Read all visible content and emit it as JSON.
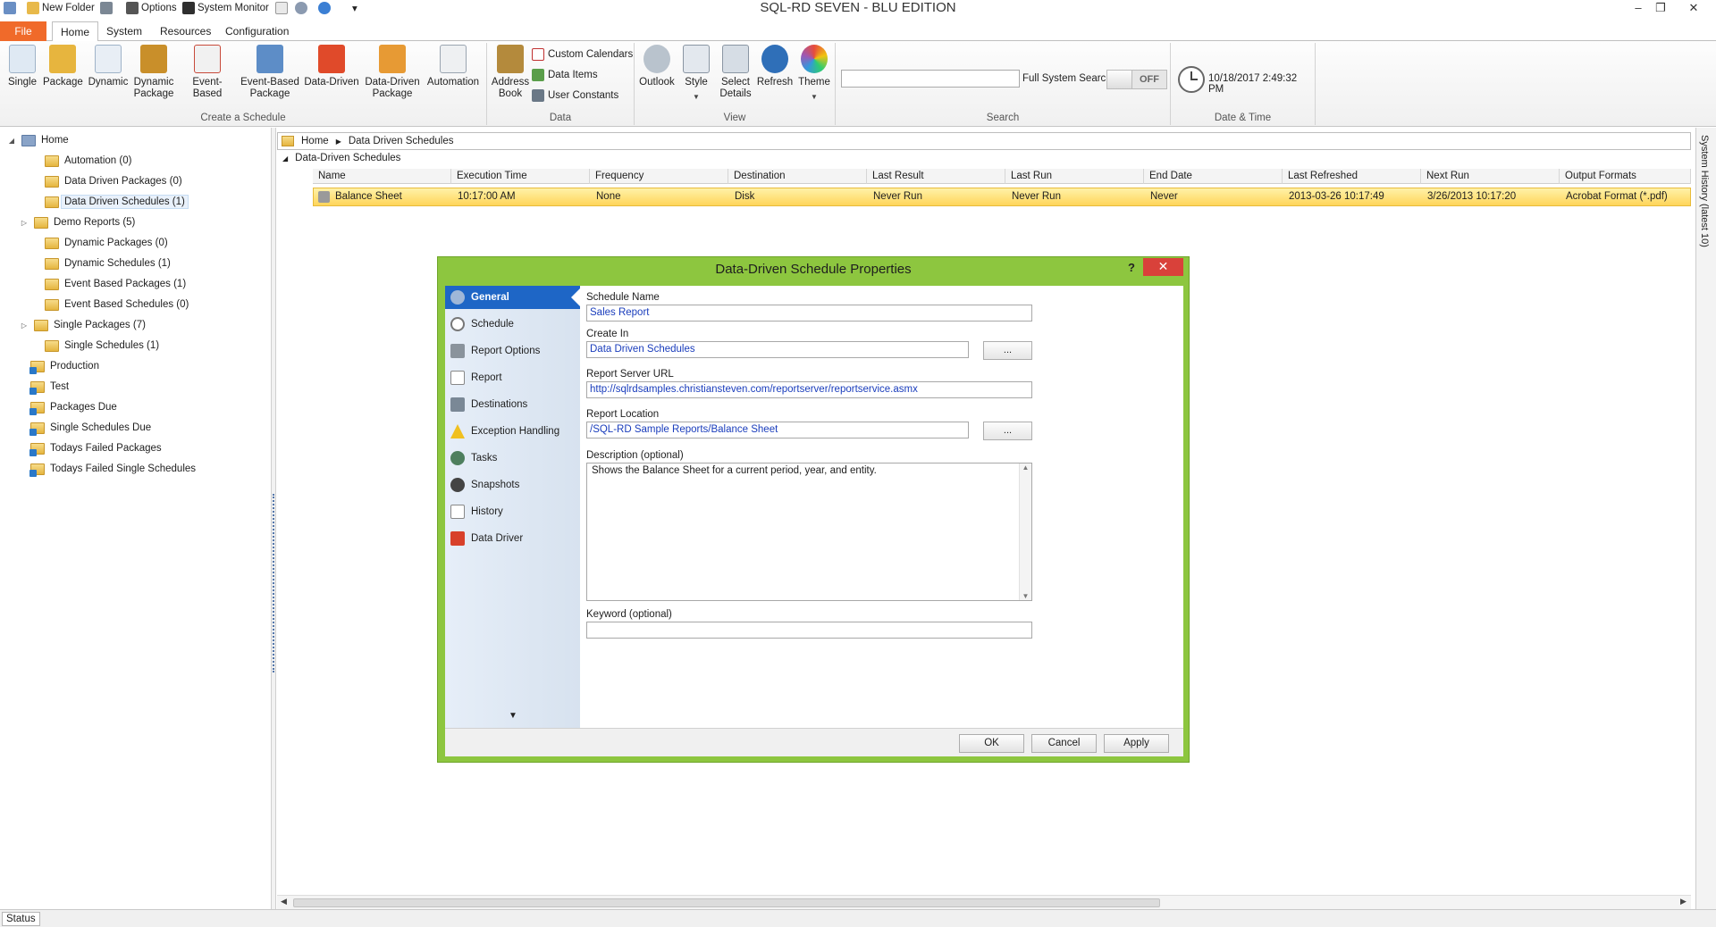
{
  "app": {
    "title": "SQL-RD SEVEN - BLU EDITION",
    "quick_access": {
      "new_folder": "New Folder",
      "options": "Options",
      "system_monitor": "System Monitor"
    }
  },
  "window_controls": {
    "minimize": "–",
    "restore": "❐",
    "close": "✕"
  },
  "tabs": {
    "file": "File",
    "home": "Home",
    "system": "System",
    "resources": "Resources",
    "configuration": "Configuration"
  },
  "ribbon": {
    "create": {
      "label": "Create a Schedule",
      "single": "Single",
      "package": "Package",
      "dynamic": "Dynamic",
      "dynamic_package_1": "Dynamic",
      "dynamic_package_2": "Package",
      "event_based": "Event-Based",
      "event_based_package_1": "Event-Based",
      "event_based_package_2": "Package",
      "data_driven": "Data-Driven",
      "data_driven_package_1": "Data-Driven",
      "data_driven_package_2": "Package",
      "automation": "Automation"
    },
    "data": {
      "label": "Data",
      "address_book_1": "Address",
      "address_book_2": "Book",
      "custom_calendars": "Custom Calendars",
      "data_items": "Data Items",
      "user_constants": "User Constants"
    },
    "view": {
      "label": "View",
      "outlook": "Outlook",
      "style": "Style",
      "select_details_1": "Select",
      "select_details_2": "Details",
      "refresh": "Refresh",
      "theme": "Theme"
    },
    "search": {
      "label": "Search",
      "value": "",
      "full_system_search": "Full System Search",
      "toggle": "OFF"
    },
    "datetime": {
      "label": "Date & Time",
      "value": "10/18/2017 2:49:32 PM"
    }
  },
  "tree": [
    {
      "label": "Home"
    },
    {
      "label": "Automation (0)"
    },
    {
      "label": "Data Driven Packages (0)"
    },
    {
      "label": "Data Driven Schedules (1)"
    },
    {
      "label": "Demo Reports (5)"
    },
    {
      "label": "Dynamic Packages (0)"
    },
    {
      "label": "Dynamic Schedules (1)"
    },
    {
      "label": "Event Based Packages (1)"
    },
    {
      "label": "Event Based Schedules (0)"
    },
    {
      "label": "Single Packages (7)"
    },
    {
      "label": "Single Schedules (1)"
    },
    {
      "label": "Production"
    },
    {
      "label": "Test"
    },
    {
      "label": "Packages Due"
    },
    {
      "label": "Single Schedules Due"
    },
    {
      "label": "Todays Failed Packages"
    },
    {
      "label": "Todays Failed Single Schedules"
    }
  ],
  "breadcrumb": {
    "home": "Home",
    "current": "Data Driven Schedules"
  },
  "grid": {
    "group": "Data-Driven Schedules",
    "columns": [
      "Name",
      "Execution Time",
      "Frequency",
      "Destination",
      "Last Result",
      "Last Run",
      "End Date",
      "Last Refreshed",
      "Next Run",
      "Output Formats"
    ],
    "rows": [
      [
        "Balance Sheet",
        "10:17:00 AM",
        "None",
        "Disk",
        "Never Run",
        "Never Run",
        "Never",
        "2013-03-26 10:17:49",
        "3/26/2013 10:17:20",
        "Acrobat Format (*.pdf)"
      ]
    ]
  },
  "right_panel": "System History (latest 10)",
  "status": "Status",
  "dialog": {
    "title": "Data-Driven Schedule Properties",
    "help": "?",
    "close": "✕",
    "nav": [
      "General",
      "Schedule",
      "Report Options",
      "Report",
      "Destinations",
      "Exception Handling",
      "Tasks",
      "Snapshots",
      "History",
      "Data Driver"
    ],
    "nav_more": "▼",
    "fields": {
      "schedule_name_label": "Schedule Name",
      "schedule_name": "Sales Report",
      "create_in_label": "Create In",
      "create_in": "Data Driven Schedules",
      "browse": "...",
      "report_server_url_label": "Report Server URL",
      "report_server_url": "http://sqlrdsamples.christiansteven.com/reportserver/reportservice.asmx",
      "report_location_label": "Report Location",
      "report_location": "/SQL-RD Sample Reports/Balance Sheet",
      "description_label": "Description (optional)",
      "description": "Shows the Balance Sheet for a current period, year, and entity.",
      "keyword_label": "Keyword (optional)",
      "keyword": ""
    },
    "buttons": {
      "ok": "OK",
      "cancel": "Cancel",
      "apply": "Apply"
    }
  },
  "colors": {
    "file_tab": "#f06a2a",
    "dialog_frame": "#8dc63f",
    "nav_active": "#1e66c6",
    "close": "#d9413a",
    "row_selected": "#ffd55a"
  }
}
